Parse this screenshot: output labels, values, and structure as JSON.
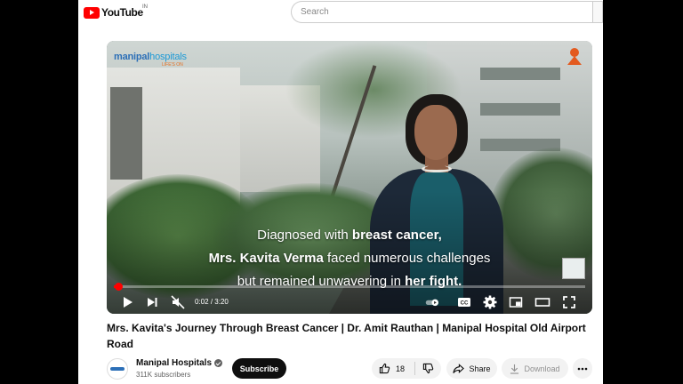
{
  "header": {
    "logo_text": "YouTube",
    "country_code": "IN",
    "search_placeholder": "Search"
  },
  "player": {
    "brand_name": "manipal",
    "brand_suffix": "hospitals",
    "brand_tagline": "LIFE'S ON",
    "caption_line1_pre": "Diagnosed with ",
    "caption_line1_bold": "breast cancer,",
    "caption_line2_bold": "Mrs. Kavita Verma",
    "caption_line2_post": " faced numerous challenges",
    "caption_line3_pre": "but remained unwavering in ",
    "caption_line3_bold": "her fight.",
    "time_current": "0:02",
    "time_total": "3:20",
    "progress": 0.01,
    "accent_color": "#ff0000"
  },
  "video": {
    "title": "Mrs. Kavita's Journey Through Breast Cancer | Dr. Amit Rauthan | Manipal Hospital Old Airport Road"
  },
  "channel": {
    "name": "Manipal Hospitals",
    "subscribers": "311K subscribers",
    "subscribe_label": "Subscribe"
  },
  "actions": {
    "like_count": "18",
    "share_label": "Share",
    "download_label": "Download"
  }
}
